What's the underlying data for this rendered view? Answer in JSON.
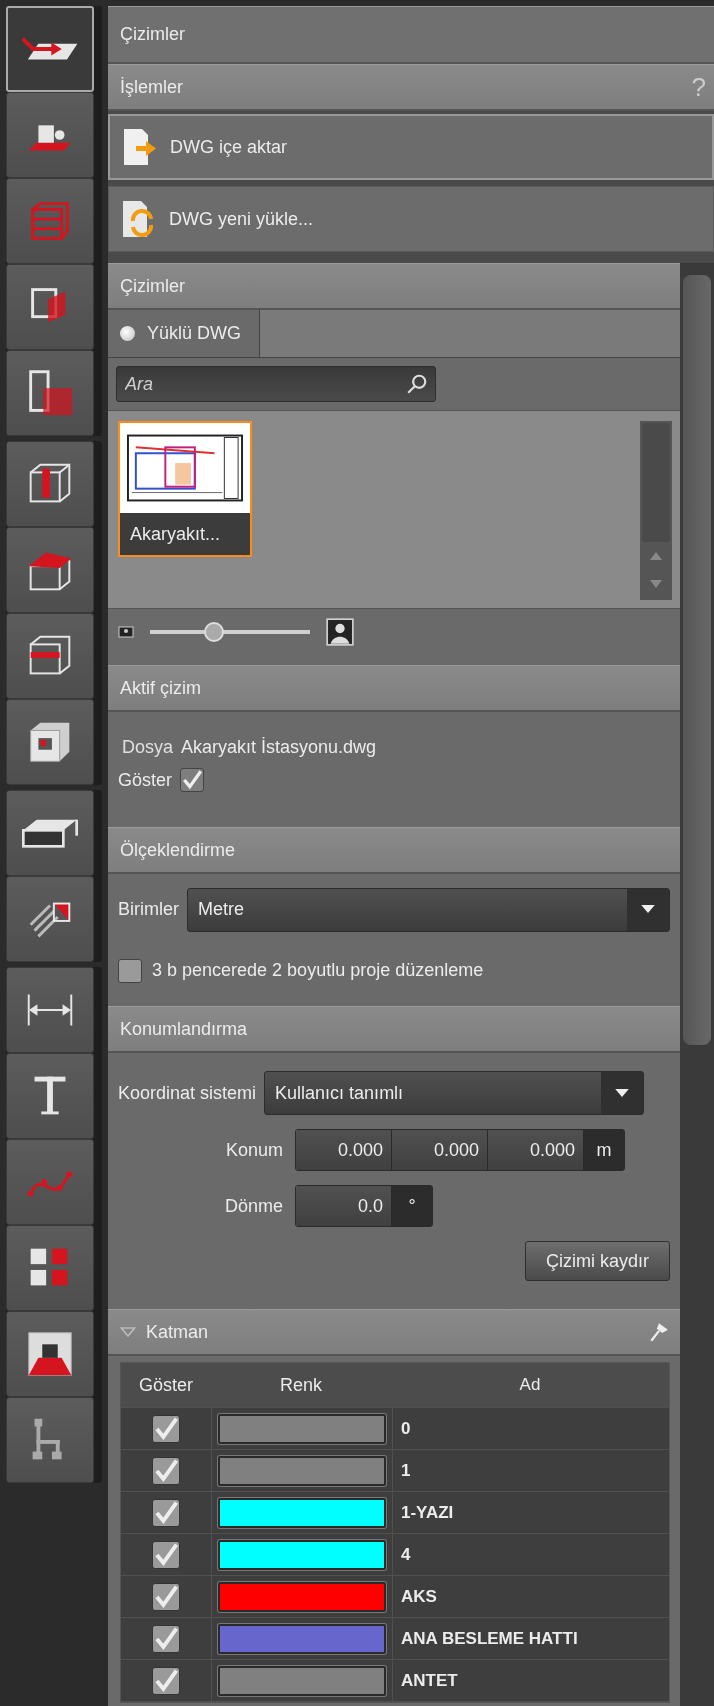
{
  "tool_groups": [
    {
      "tools": [
        {
          "selected": true
        },
        {
          "selected": false
        },
        {
          "selected": false
        },
        {
          "selected": false
        },
        {
          "selected": false
        }
      ]
    },
    {
      "tools": [
        {
          "selected": false
        },
        {
          "selected": false
        },
        {
          "selected": false
        },
        {
          "selected": false
        }
      ]
    },
    {
      "tools": [
        {
          "selected": false
        },
        {
          "selected": false
        }
      ]
    },
    {
      "tools": [
        {
          "selected": false
        },
        {
          "selected": false
        },
        {
          "selected": false
        },
        {
          "selected": false
        },
        {
          "selected": false
        },
        {
          "selected": false
        }
      ]
    }
  ],
  "title": "Çizimler",
  "operations": {
    "title": "İşlemler",
    "help": "?",
    "buttons": [
      {
        "label": "DWG içe aktar",
        "selected": true
      },
      {
        "label": "DWG yeni yükle...",
        "selected": false
      }
    ]
  },
  "drawings": {
    "title": "Çizimler",
    "tabs": [
      {
        "label": "Yüklü DWG",
        "selected": true
      }
    ],
    "search": {
      "placeholder": "Ara"
    },
    "items": [
      {
        "label": "Akaryakıt...",
        "selected": true
      }
    ],
    "zoom_slider": {
      "level": 0.4
    }
  },
  "active_drawing": {
    "title": "Aktif çizim",
    "file_label": "Dosya",
    "file_name": "Akaryakıt İstasyonu.dwg",
    "show_label": "Göster",
    "show_checked": true
  },
  "scaling": {
    "title": "Ölçeklendirme",
    "units_label": "Birimler",
    "units_value": "Metre",
    "edit_2d_label": "3 b pencerede 2 boyutlu proje düzenleme",
    "edit_2d_checked": false
  },
  "positioning": {
    "title": "Konumlandırma",
    "coord_label": "Koordinat sistemi",
    "coord_value": "Kullanıcı tanımlı",
    "position_label": "Konum",
    "position_values": [
      "0.000",
      "0.000",
      "0.000"
    ],
    "position_unit": "m",
    "rotation_label": "Dönme",
    "rotation_value": "0.0",
    "rotation_unit": "°",
    "move_button": "Çizimi kaydır"
  },
  "layers": {
    "title": "Katman",
    "columns": [
      "Göster",
      "Renk",
      "Ad"
    ],
    "rows": [
      {
        "show": true,
        "color": "#808080",
        "name": "0"
      },
      {
        "show": true,
        "color": "#808080",
        "name": "1"
      },
      {
        "show": true,
        "color": "#00ffff",
        "name": "1-YAZI"
      },
      {
        "show": true,
        "color": "#00ffff",
        "name": "4"
      },
      {
        "show": true,
        "color": "#ff0000",
        "name": "AKS"
      },
      {
        "show": true,
        "color": "#6666cc",
        "name": "ANA BESLEME HATTI"
      },
      {
        "show": true,
        "color": "#808080",
        "name": "ANTET"
      }
    ]
  }
}
